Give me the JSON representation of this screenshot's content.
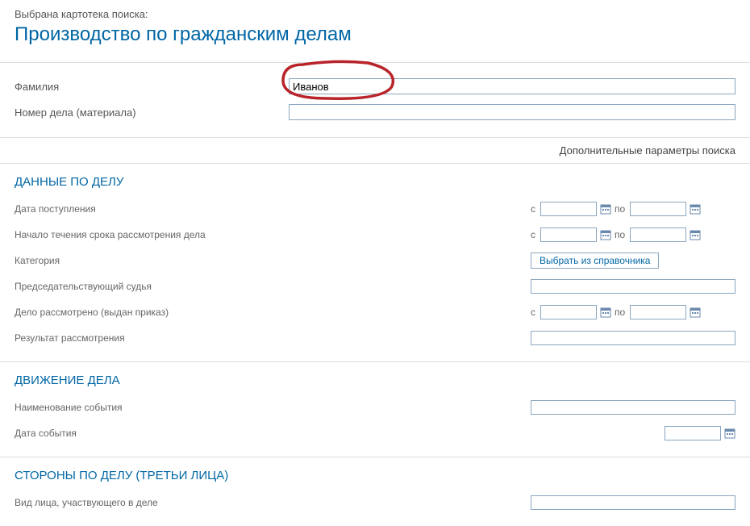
{
  "header": {
    "label": "Выбрана картотека поиска:",
    "title": "Производство по гражданским делам"
  },
  "topFields": {
    "surname": {
      "label": "Фамилия",
      "value": "Иванов"
    },
    "caseNumber": {
      "label": "Номер дела (материала)",
      "value": ""
    }
  },
  "additionalParams": "Дополнительные параметры поиска",
  "sections": {
    "caseData": {
      "title": "ДАННЫЕ ПО ДЕЛУ",
      "rows": {
        "receiptDate": {
          "label": "Дата поступления",
          "from": "с",
          "to": "по"
        },
        "reviewStart": {
          "label": "Начало течения срока рассмотрения дела",
          "from": "с",
          "to": "по"
        },
        "category": {
          "label": "Категория",
          "button": "Выбрать из справочника"
        },
        "judge": {
          "label": "Председательствующий судья"
        },
        "reviewed": {
          "label": "Дело рассмотрено (выдан приказ)",
          "from": "с",
          "to": "по"
        },
        "result": {
          "label": "Результат рассмотрения"
        }
      }
    },
    "movement": {
      "title": "ДВИЖЕНИЕ ДЕЛА",
      "rows": {
        "eventName": {
          "label": "Наименование события"
        },
        "eventDate": {
          "label": "Дата события"
        }
      }
    },
    "parties": {
      "title": "СТОРОНЫ ПО ДЕЛУ (ТРЕТЬИ ЛИЦА)",
      "rows": {
        "partyType": {
          "label": "Вид лица, участвующего в деле"
        }
      }
    }
  }
}
